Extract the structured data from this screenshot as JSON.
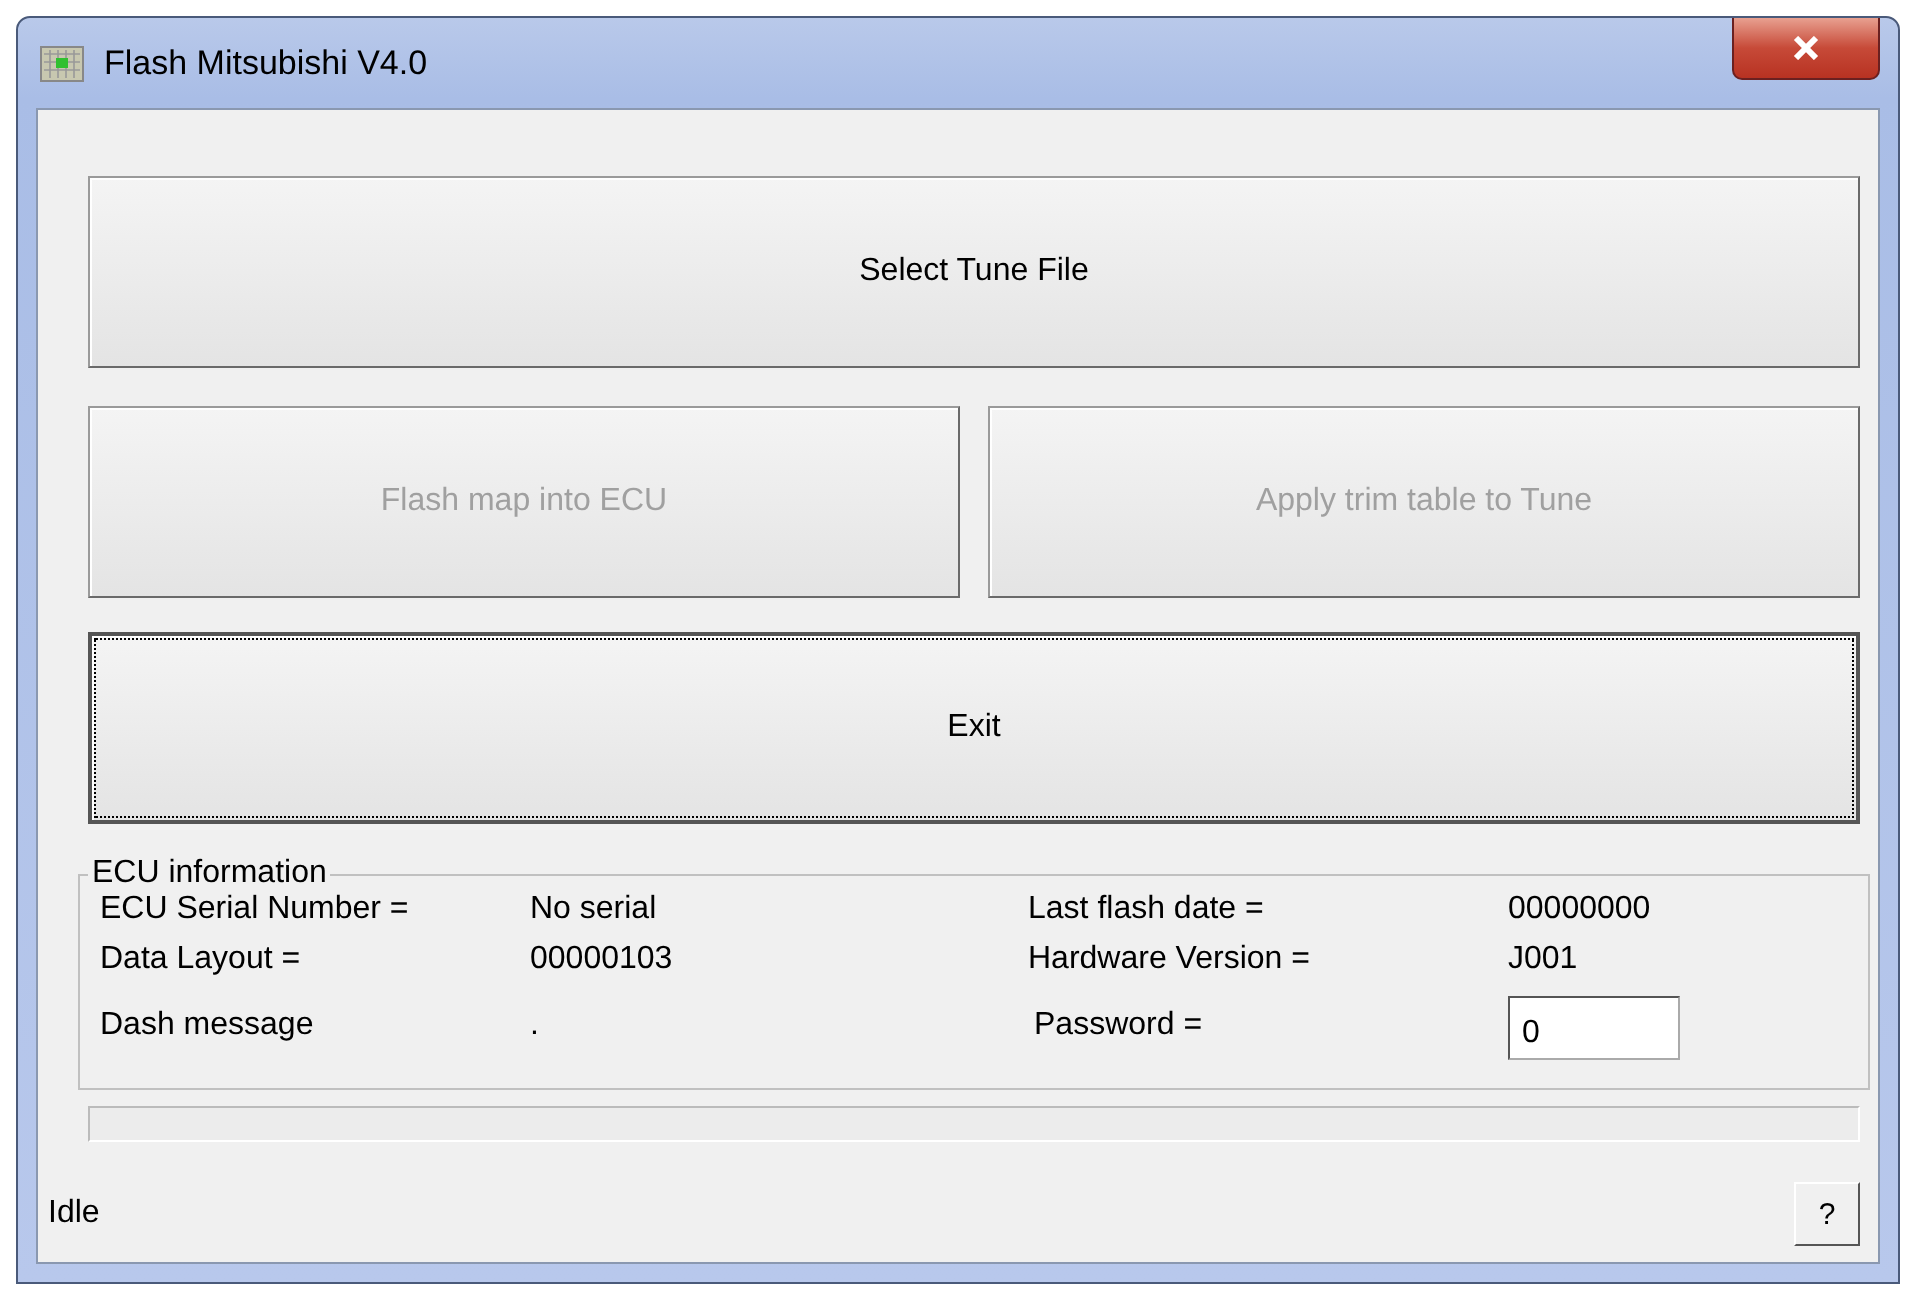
{
  "window": {
    "title": "Flash Mitsubishi V4.0"
  },
  "buttons": [
    {
      "kind": "wide",
      "label": "Select Tune File",
      "disabled": false,
      "focused": false
    },
    {
      "kind": "half",
      "label": "Flash map into ECU",
      "disabled": true,
      "focused": false
    },
    {
      "kind": "half",
      "label": "Apply trim table to Tune",
      "disabled": true,
      "focused": false
    },
    {
      "kind": "wide",
      "label": "Exit",
      "disabled": false,
      "focused": true
    }
  ],
  "ecu_information": {
    "title": "ECU information",
    "left": [
      {
        "label": "ECU Serial Number =",
        "value": "No serial"
      },
      {
        "label": "Data Layout =",
        "value": "00000103"
      },
      {
        "label": "Dash message",
        "value": "."
      }
    ],
    "right": [
      {
        "label": "Last flash date =",
        "value": "00000000"
      },
      {
        "label": "Hardware Version =",
        "value": "J001"
      }
    ],
    "password": {
      "label": "Password =",
      "value": "0"
    }
  },
  "progress": {
    "level": 0
  },
  "status_bar": {
    "text": "Idle",
    "help_button": "?"
  }
}
